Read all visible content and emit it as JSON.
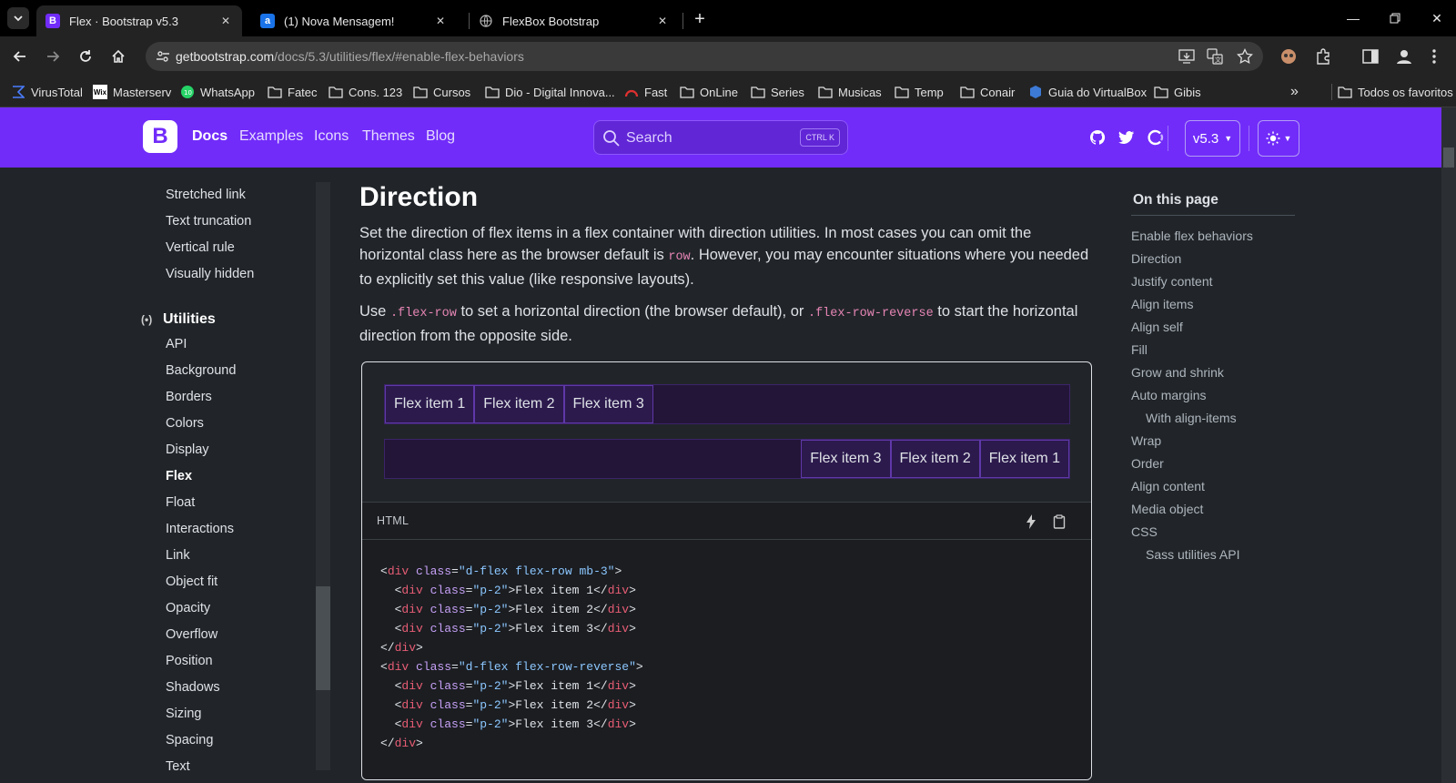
{
  "browser": {
    "tabs": [
      {
        "title": "Flex · Bootstrap v5.3",
        "favicon": "B",
        "active": true
      },
      {
        "title": "(1) Nova Mensagem!",
        "favicon": "a",
        "active": false
      },
      {
        "title": "FlexBox Bootstrap",
        "favicon": "globe",
        "active": false
      }
    ],
    "url_host": "getbootstrap.com",
    "url_path": "/docs/5.3/utilities/flex/#enable-flex-behaviors",
    "bookmarks": [
      {
        "label": "VirusTotal",
        "icon": "virustotal-icon"
      },
      {
        "label": "Masterserv",
        "icon": "wix-icon"
      },
      {
        "label": "WhatsApp",
        "icon": "whatsapp-icon"
      },
      {
        "label": "Fatec",
        "icon": "folder-icon"
      },
      {
        "label": "Cons. 123",
        "icon": "folder-icon"
      },
      {
        "label": "Cursos",
        "icon": "folder-icon"
      },
      {
        "label": "Dio - Digital Innova...",
        "icon": "folder-icon"
      },
      {
        "label": "Fast",
        "icon": "speedometer-icon"
      },
      {
        "label": "OnLine",
        "icon": "folder-icon"
      },
      {
        "label": "Series",
        "icon": "folder-icon"
      },
      {
        "label": "Musicas",
        "icon": "folder-icon"
      },
      {
        "label": "Temp",
        "icon": "folder-icon"
      },
      {
        "label": "Conair",
        "icon": "folder-icon"
      },
      {
        "label": "Guia do VirtualBox",
        "icon": "virtualbox-icon"
      },
      {
        "label": "Gibis",
        "icon": "folder-icon"
      }
    ],
    "all_bookmarks": "Todos os favoritos",
    "more_bookmarks": "»"
  },
  "bs_nav": {
    "logo": "B",
    "links": [
      "Docs",
      "Examples",
      "Icons",
      "Themes",
      "Blog"
    ],
    "search_placeholder": "Search",
    "search_kbd": "CTRL K",
    "version": "v5.3",
    "accent": "#712cf9"
  },
  "sidebar": {
    "items_top": [
      "Stretched link",
      "Text truncation",
      "Vertical rule",
      "Visually hidden"
    ],
    "group_label": "Utilities",
    "group_icon": "(•)",
    "items": [
      "API",
      "Background",
      "Borders",
      "Colors",
      "Display",
      "Flex",
      "Float",
      "Interactions",
      "Link",
      "Object fit",
      "Opacity",
      "Overflow",
      "Position",
      "Shadows",
      "Sizing",
      "Spacing",
      "Text"
    ],
    "active": "Flex"
  },
  "content": {
    "heading": "Direction",
    "p1_a": "Set the direction of flex items in a flex container with direction utilities. In most cases you can omit the horizontal class here as the browser default is ",
    "p1_code": "row",
    "p1_b": ". However, you may encounter situations where you needed to explicitly set this value (like responsive layouts).",
    "p2_a": "Use ",
    "p2_code1": ".flex-row",
    "p2_b": " to set a horizontal direction (the browser default), or ",
    "p2_code2": ".flex-row-reverse",
    "p2_c": " to start the horizontal direction from the opposite side.",
    "row1": [
      "Flex item 1",
      "Flex item 2",
      "Flex item 3"
    ],
    "row2": [
      "Flex item 3",
      "Flex item 2",
      "Flex item 1"
    ],
    "code_label": "HTML",
    "code_lines": [
      [
        "<",
        "div",
        " class",
        "=",
        "\"d-flex flex-row mb-3\"",
        ">",
        ""
      ],
      [
        "  <",
        "div",
        " class",
        "=",
        "\"p-2\"",
        ">",
        "Flex item 1</div>"
      ],
      [
        "  <",
        "div",
        " class",
        "=",
        "\"p-2\"",
        ">",
        "Flex item 2</div>"
      ],
      [
        "  <",
        "div",
        " class",
        "=",
        "\"p-2\"",
        ">",
        "Flex item 3</div>"
      ],
      [
        "</",
        "div",
        "",
        "",
        "",
        ">",
        ""
      ],
      [
        "<",
        "div",
        " class",
        "=",
        "\"d-flex flex-row-reverse\"",
        ">",
        ""
      ],
      [
        "  <",
        "div",
        " class",
        "=",
        "\"p-2\"",
        ">",
        "Flex item 1</div>"
      ],
      [
        "  <",
        "div",
        " class",
        "=",
        "\"p-2\"",
        ">",
        "Flex item 2</div>"
      ],
      [
        "  <",
        "div",
        " class",
        "=",
        "\"p-2\"",
        ">",
        "Flex item 3</div>"
      ],
      [
        "</",
        "div",
        "",
        "",
        "",
        ">",
        ""
      ]
    ]
  },
  "toc": {
    "title": "On this page",
    "items": [
      {
        "label": "Enable flex behaviors",
        "sub": false
      },
      {
        "label": "Direction",
        "sub": false
      },
      {
        "label": "Justify content",
        "sub": false
      },
      {
        "label": "Align items",
        "sub": false
      },
      {
        "label": "Align self",
        "sub": false
      },
      {
        "label": "Fill",
        "sub": false
      },
      {
        "label": "Grow and shrink",
        "sub": false
      },
      {
        "label": "Auto margins",
        "sub": false
      },
      {
        "label": "With align-items",
        "sub": true
      },
      {
        "label": "Wrap",
        "sub": false
      },
      {
        "label": "Order",
        "sub": false
      },
      {
        "label": "Align content",
        "sub": false
      },
      {
        "label": "Media object",
        "sub": false
      },
      {
        "label": "CSS",
        "sub": false
      },
      {
        "label": "Sass utilities API",
        "sub": true
      }
    ]
  }
}
